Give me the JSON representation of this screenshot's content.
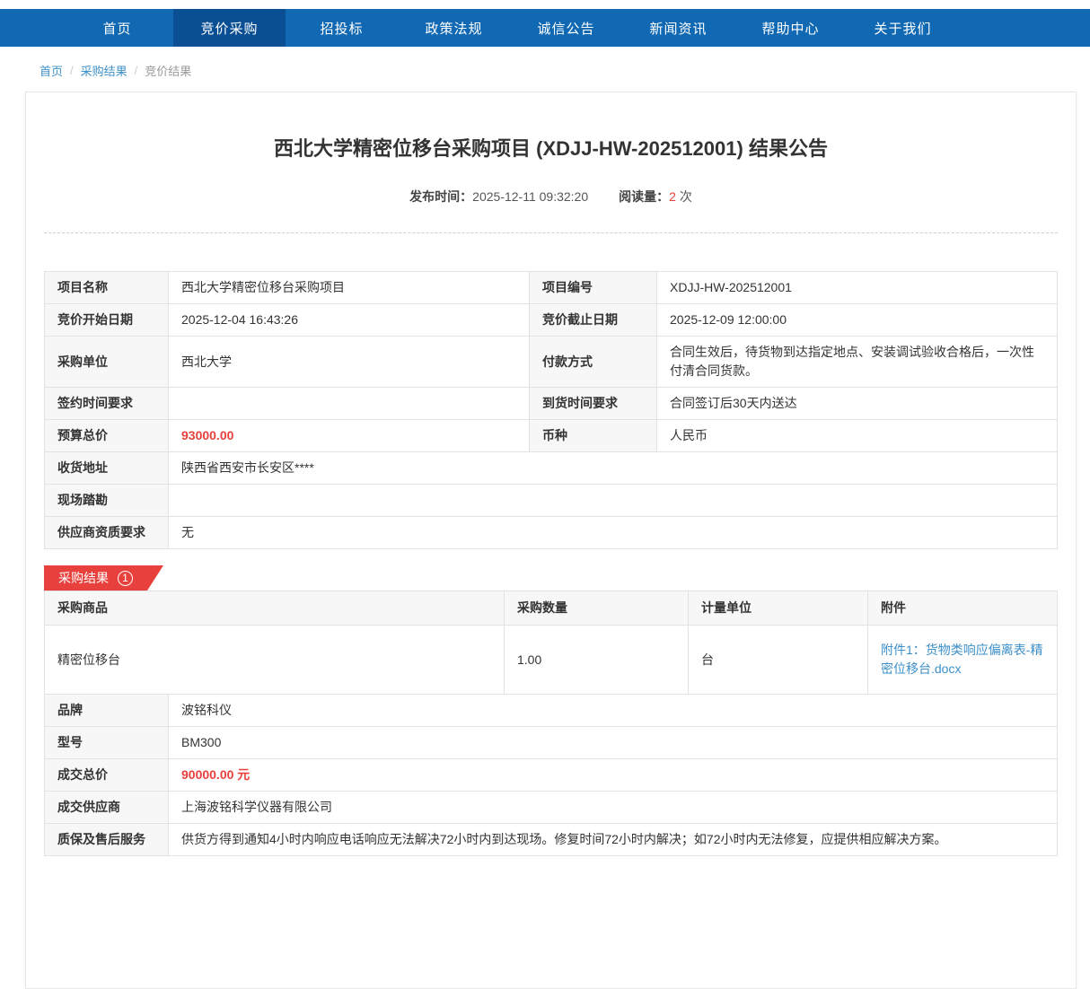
{
  "colors": {
    "nav_bg": "#1169b4",
    "nav_active_bg": "#0a4f94",
    "accent_red": "#e8413d",
    "link_blue": "#3d8fc9"
  },
  "nav": {
    "items": [
      {
        "label": "首页"
      },
      {
        "label": "竞价采购"
      },
      {
        "label": "招投标"
      },
      {
        "label": "政策法规"
      },
      {
        "label": "诚信公告"
      },
      {
        "label": "新闻资讯"
      },
      {
        "label": "帮助中心"
      },
      {
        "label": "关于我们"
      }
    ],
    "active_index": 1
  },
  "breadcrumb": {
    "items": [
      "首页",
      "采购结果",
      "竞价结果"
    ]
  },
  "article": {
    "title": "西北大学精密位移台采购项目 (XDJJ-HW-202512001) 结果公告",
    "publish_label": "发布时间：",
    "publish_time": "2025-12-11 09:32:20",
    "views_label": "阅读量：",
    "views_count": "2",
    "views_unit": "次"
  },
  "info_table": {
    "rows4": [
      {
        "l1": "项目名称",
        "v1": "西北大学精密位移台采购项目",
        "l2": "项目编号",
        "v2": "XDJJ-HW-202512001"
      },
      {
        "l1": "竞价开始日期",
        "v1": "2025-12-04 16:43:26",
        "l2": "竞价截止日期",
        "v2": "2025-12-09 12:00:00"
      },
      {
        "l1": "采购单位",
        "v1": "西北大学",
        "l2": "付款方式",
        "v2": "合同生效后，待货物到达指定地点、安装调试验收合格后，一次性付清合同货款。"
      },
      {
        "l1": "签约时间要求",
        "v1": "",
        "l2": "到货时间要求",
        "v2": "合同签订后30天内送达"
      },
      {
        "l1": "预算总价",
        "v1": "93000.00",
        "l2": "币种",
        "v2": "人民币"
      }
    ],
    "rows2": [
      {
        "label": "收货地址",
        "value": "陕西省西安市长安区****"
      },
      {
        "label": "现场踏勘",
        "value": ""
      },
      {
        "label": "供应商资质要求",
        "value": "无"
      }
    ]
  },
  "result": {
    "badge_label": "采购结果",
    "badge_number": "1",
    "columns": [
      "采购商品",
      "采购数量",
      "计量单位",
      "附件"
    ],
    "item": {
      "name": "精密位移台",
      "qty": "1.00",
      "unit": "台",
      "attachment": "附件1：货物类响应偏离表-精密位移台.docx"
    },
    "details": [
      {
        "label": "品牌",
        "value": "波铭科仪"
      },
      {
        "label": "型号",
        "value": "BM300"
      },
      {
        "label": "成交总价",
        "value": "90000.00 元"
      },
      {
        "label": "成交供应商",
        "value": "上海波铭科学仪器有限公司"
      },
      {
        "label": "质保及售后服务",
        "value": "供货方得到通知4小时内响应电话响应无法解决72小时内到达现场。修复时间72小时内解决；如72小时内无法修复，应提供相应解决方案。"
      }
    ]
  }
}
